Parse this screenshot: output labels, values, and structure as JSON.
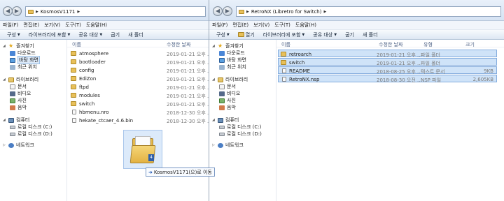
{
  "left": {
    "path": "KosmosV1171",
    "menu": [
      "파일(F)",
      "편집(E)",
      "보기(V)",
      "도구(T)",
      "도움말(H)"
    ],
    "toolbar": [
      "구성",
      "라이브러리에 포함",
      "공유 대상",
      "굽기",
      "새 폴더"
    ],
    "columns": {
      "name": "이름",
      "date": "수정한 날짜"
    },
    "files": [
      {
        "name": "atmosphere",
        "date": "2019-01-21 오후 ...",
        "type": "folder"
      },
      {
        "name": "bootloader",
        "date": "2019-01-21 오후 ...",
        "type": "folder"
      },
      {
        "name": "config",
        "date": "2019-01-21 오후 ...",
        "type": "folder"
      },
      {
        "name": "EdiZon",
        "date": "2019-01-21 오후 ...",
        "type": "folder"
      },
      {
        "name": "ftpd",
        "date": "2019-01-21 오후 ...",
        "type": "folder"
      },
      {
        "name": "modules",
        "date": "2019-01-21 오후 ...",
        "type": "folder"
      },
      {
        "name": "switch",
        "date": "2019-01-21 오후 ...",
        "type": "folder"
      },
      {
        "name": "hbmenu.nro",
        "date": "2018-12-30 오후 ...",
        "type": "file"
      },
      {
        "name": "hekate_ctcaer_4.6.bin",
        "date": "2018-12-30 오후 ...",
        "type": "file"
      }
    ]
  },
  "right": {
    "path": "RetroNX (Libretro for Switch)",
    "menu": [
      "파일(F)",
      "편집(E)",
      "보기(V)",
      "도구(T)",
      "도움말(H)"
    ],
    "toolbar": [
      "구성",
      "열기",
      "라이브러리에 포함",
      "공유 대상",
      "굽기",
      "새 폴더"
    ],
    "columns": {
      "name": "이름",
      "date": "수정한 날짜",
      "type": "유형",
      "size": "크기"
    },
    "files": [
      {
        "name": "retroarch",
        "date": "2019-01-21 오후 ...",
        "type": "파일 폴더",
        "size": "",
        "kind": "folder",
        "selected": true
      },
      {
        "name": "switch",
        "date": "2019-01-21 오후 ...",
        "type": "파일 폴더",
        "size": "",
        "kind": "folder",
        "selected": true
      },
      {
        "name": "README",
        "date": "2018-08-25 오후 ...",
        "type": "텍스트 문서",
        "size": "9KB",
        "kind": "file",
        "selected": true
      },
      {
        "name": "RetroNX.nsp",
        "date": "2018-08-30 오전 ...",
        "type": "NSP 파일",
        "size": "2,605KB",
        "kind": "file",
        "selected": true
      }
    ]
  },
  "nav": {
    "favorites": "즐겨찾기",
    "downloads": "다운로드",
    "desktop": "바탕 화면",
    "recent": "최근 위치",
    "libraries": "라이브러리",
    "documents": "문서",
    "videos": "비디오",
    "pictures": "사진",
    "music": "음악",
    "computer": "컴퓨터",
    "drive_c": "로컬 디스크 (C:)",
    "drive_d": "로컬 디스크 (D:)",
    "network": "네트워크"
  },
  "drag": {
    "badge": "4",
    "tooltip": "KosmosV1171(으)로 이동"
  }
}
